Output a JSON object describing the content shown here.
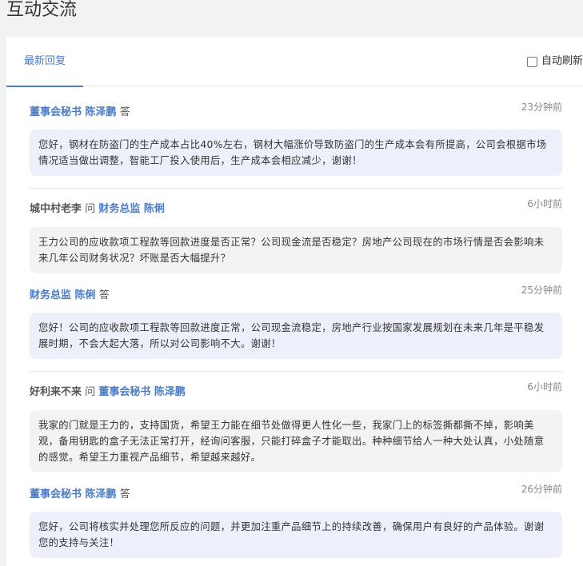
{
  "page": {
    "title": "互动交流"
  },
  "tabs": [
    {
      "label": "最新回复",
      "active": true
    }
  ],
  "auto_refresh": {
    "label": "自动刷新",
    "checked": false
  },
  "feed": [
    {
      "kind": "answer",
      "responder_role": "董事会秘书",
      "responder_name": "陈泽鹏",
      "verb": "答",
      "time": "23分钟前",
      "text": "您好，钢材在防盗门的生产成本占比40%左右，钢材大幅涨价导致防盗门的生产成本会有所提高，公司会根据市场情况适当做出调整，智能工厂投入使用后，生产成本会相应减少，谢谢！"
    },
    {
      "kind": "question",
      "asker": "城中村老李",
      "verb": "问",
      "target_role": "财务总监",
      "target_name": "陈俐",
      "time": "6小时前",
      "text": "王力公司的应收款项工程款等回款进度是否正常？公司现金流是否稳定？房地产公司现在的市场行情是否会影响未来几年公司财务状况？坏账是否大幅提升？"
    },
    {
      "kind": "answer",
      "responder_role": "财务总监",
      "responder_name": "陈俐",
      "verb": "答",
      "time": "25分钟前",
      "text": "您好！公司的应收款项工程款等回款进度正常，公司现金流稳定，房地产行业按国家发展规划在未来几年是平稳发展时期，不会大起大落，所以对公司影响不大。谢谢！"
    },
    {
      "kind": "question",
      "asker": "好利来不来",
      "verb": "问",
      "target_role": "董事会秘书",
      "target_name": "陈泽鹏",
      "time": "6小时前",
      "text": "我家的门就是王力的，支持国货，希望王力能在细节处做得更人性化一些，我家门上的标签撕都撕不掉，影响美观，备用钥匙的盒子无法正常打开，经询问客服，只能打碎盒子才能取出。种种细节给人一种大处认真，小处随意的感觉。希望王力重视产品细节，希望越来越好。"
    },
    {
      "kind": "answer",
      "responder_role": "董事会秘书",
      "responder_name": "陈泽鹏",
      "verb": "答",
      "time": "26分钟前",
      "text": "您好，公司将核实并处理您所反应的问题，并更加注重产品细节上的持续改善，确保用户有良好的产品体验。谢谢您的支持与关注！"
    }
  ]
}
